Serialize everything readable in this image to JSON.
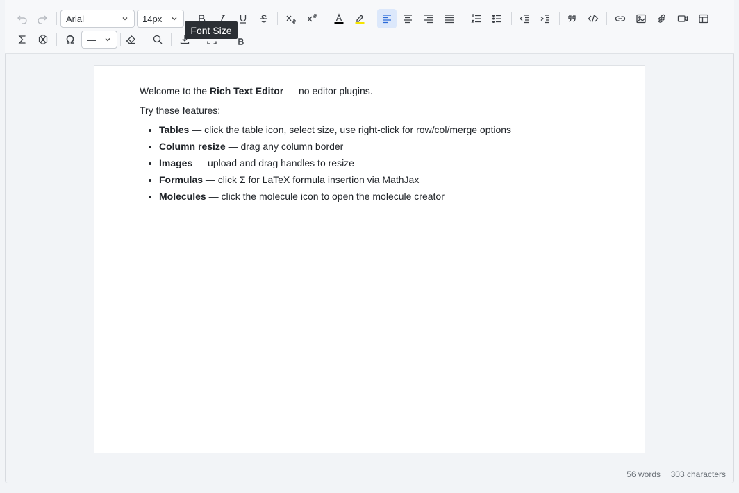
{
  "toolbar": {
    "font_family": "Arial",
    "font_size": "14px",
    "line_height_value": "—",
    "tooltip": "Font Size"
  },
  "document": {
    "intro_prefix": "Welcome to the ",
    "intro_bold": "Rich Text Editor",
    "intro_suffix": " — no editor plugins.",
    "try_line": "Try these features:",
    "features": [
      {
        "title": "Tables",
        "desc": " — click the table icon, select size, use right-click for row/col/merge options"
      },
      {
        "title": "Column resize",
        "desc": " — drag any column border"
      },
      {
        "title": "Images",
        "desc": " — upload and drag handles to resize"
      },
      {
        "title": "Formulas",
        "desc": " — click Σ for LaTeX formula insertion via MathJax"
      },
      {
        "title": "Molecules",
        "desc": " — click the molecule icon to open the molecule creator"
      }
    ]
  },
  "status": {
    "words": "56 words",
    "characters": "303 characters"
  },
  "colors": {
    "text_color_bar": "#000000",
    "highlight_bar": "#f5e400",
    "active_bg": "#dce8fb",
    "active_fg": "#2a6ad8"
  }
}
